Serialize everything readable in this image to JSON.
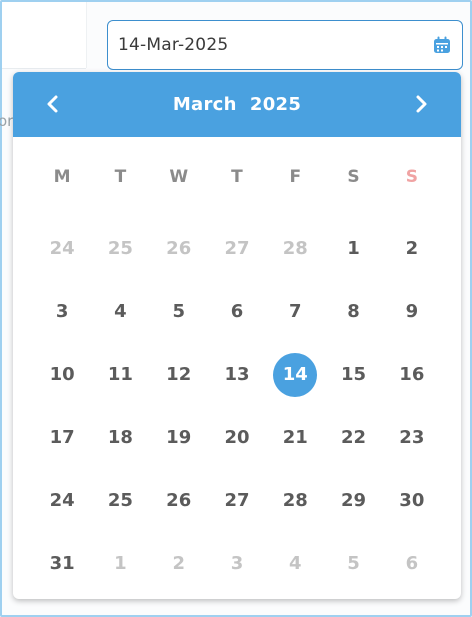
{
  "input": {
    "value": "14-Mar-2025",
    "icon": "calendar-icon"
  },
  "background": {
    "fragment_text": "or"
  },
  "calendar": {
    "month_label": "March",
    "year_label": "2025",
    "prev_icon": "chevron-left-icon",
    "next_icon": "chevron-right-icon",
    "accent_color": "#4aa1e0",
    "weekdays": [
      "M",
      "T",
      "W",
      "T",
      "F",
      "S",
      "S"
    ],
    "selected_day": "14",
    "weeks": [
      [
        {
          "d": "24",
          "m": true
        },
        {
          "d": "25",
          "m": true
        },
        {
          "d": "26",
          "m": true
        },
        {
          "d": "27",
          "m": true
        },
        {
          "d": "28",
          "m": true
        },
        {
          "d": "1",
          "m": false
        },
        {
          "d": "2",
          "m": false
        }
      ],
      [
        {
          "d": "3",
          "m": false
        },
        {
          "d": "4",
          "m": false
        },
        {
          "d": "5",
          "m": false
        },
        {
          "d": "6",
          "m": false
        },
        {
          "d": "7",
          "m": false
        },
        {
          "d": "8",
          "m": false
        },
        {
          "d": "9",
          "m": false
        }
      ],
      [
        {
          "d": "10",
          "m": false
        },
        {
          "d": "11",
          "m": false
        },
        {
          "d": "12",
          "m": false
        },
        {
          "d": "13",
          "m": false
        },
        {
          "d": "14",
          "m": false
        },
        {
          "d": "15",
          "m": false
        },
        {
          "d": "16",
          "m": false
        }
      ],
      [
        {
          "d": "17",
          "m": false
        },
        {
          "d": "18",
          "m": false
        },
        {
          "d": "19",
          "m": false
        },
        {
          "d": "20",
          "m": false
        },
        {
          "d": "21",
          "m": false
        },
        {
          "d": "22",
          "m": false
        },
        {
          "d": "23",
          "m": false
        }
      ],
      [
        {
          "d": "24",
          "m": false
        },
        {
          "d": "25",
          "m": false
        },
        {
          "d": "26",
          "m": false
        },
        {
          "d": "27",
          "m": false
        },
        {
          "d": "28",
          "m": false
        },
        {
          "d": "29",
          "m": false
        },
        {
          "d": "30",
          "m": false
        }
      ],
      [
        {
          "d": "31",
          "m": false
        },
        {
          "d": "1",
          "m": true
        },
        {
          "d": "2",
          "m": true
        },
        {
          "d": "3",
          "m": true
        },
        {
          "d": "4",
          "m": true
        },
        {
          "d": "5",
          "m": true
        },
        {
          "d": "6",
          "m": true
        }
      ]
    ]
  }
}
